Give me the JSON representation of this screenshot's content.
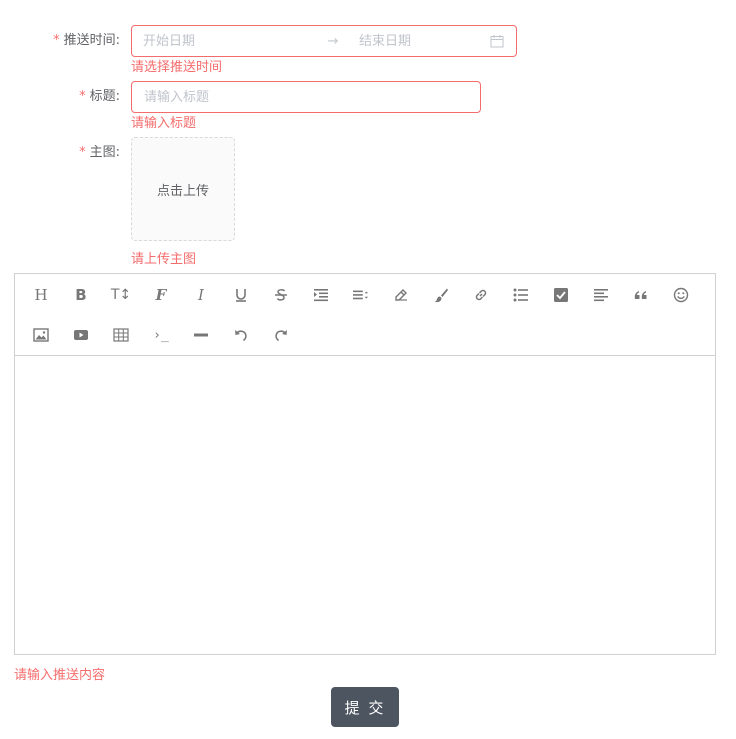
{
  "form": {
    "push_time": {
      "label": "推送时间:",
      "start_placeholder": "开始日期",
      "separator": "→",
      "end_placeholder": "结束日期",
      "error": "请选择推送时间"
    },
    "title": {
      "label": "标题:",
      "placeholder": "请输入标题",
      "error": "请输入标题"
    },
    "main_image": {
      "label": "主图:",
      "upload_text": "点击上传",
      "error": "请上传主图"
    },
    "required_mark": "*",
    "content_error": "请输入推送内容",
    "submit_label": "提 交"
  },
  "editor": {
    "toolbar_row1": [
      "heading-icon",
      "bold-icon",
      "font-size-icon",
      "font-family-icon",
      "italic-icon",
      "underline-icon",
      "strikethrough-icon",
      "indent-icon",
      "line-height-icon",
      "font-color-icon",
      "background-color-icon",
      "link-icon",
      "list-icon",
      "todo-icon",
      "justify-icon",
      "quote-icon",
      "emoticon-icon"
    ],
    "toolbar_row2": [
      "image-icon",
      "video-icon",
      "table-icon",
      "code-icon",
      "divider-icon",
      "undo-icon",
      "redo-icon"
    ],
    "toolbar_text": {
      "heading": "H",
      "bold": "B",
      "font_size": "T↕",
      "font_family": "F",
      "italic": "I",
      "code": "›_"
    }
  },
  "colors": {
    "error": "#f56c6c",
    "placeholder": "#c0c4cc",
    "label": "#606266",
    "submit_bg": "#4d5561"
  }
}
